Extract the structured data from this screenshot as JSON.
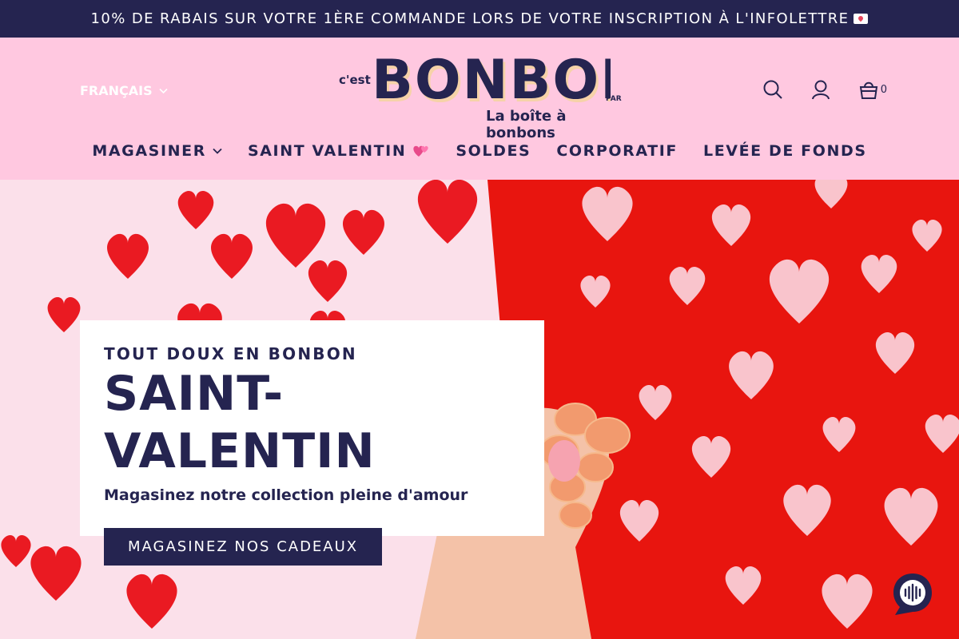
{
  "announcement": {
    "text": "10% DE RABAIS SUR VOTRE 1ÈRE COMMANDE LORS DE VOTRE INSCRIPTION À L'INFOLETTRE",
    "icon": "love-letter-icon"
  },
  "header": {
    "language": "FRANÇAIS",
    "logo": {
      "prefix": "c'est",
      "brand": "BONBON",
      "suffix": "PAR",
      "tagline": "La boîte à bonbons"
    },
    "cart_count": "0",
    "icons": [
      "search-icon",
      "account-icon",
      "cart-icon"
    ]
  },
  "nav": {
    "items": [
      {
        "label": "MAGASINER"
      },
      {
        "label": "SAINT VALENTIN"
      },
      {
        "label": "SOLDES"
      },
      {
        "label": "CORPORATIF"
      },
      {
        "label": "LEVÉE DE FONDS"
      }
    ]
  },
  "hero": {
    "kicker": "TOUT DOUX EN BONBON",
    "title": "SAINT-VALENTIN",
    "subtitle": "Magasinez notre collection pleine d'amour",
    "cta": "MAGASINEZ NOS CADEAUX"
  },
  "colors": {
    "navy": "#252450",
    "pink": "#ffc8e0",
    "red": "#e8150f"
  }
}
